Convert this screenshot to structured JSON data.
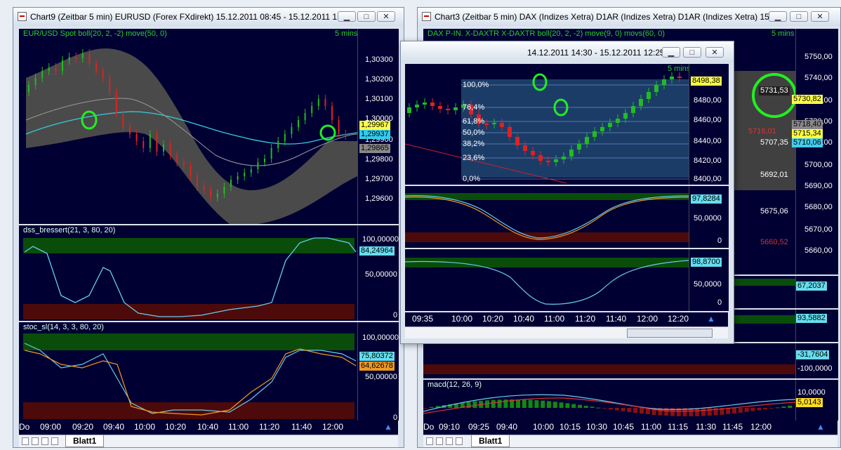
{
  "left": {
    "title": "Chart9 (Zeitbar 5 min)  EURUSD (Forex FXdirekt) 15.12.2011 08:45 - 15.12.2011 1...",
    "price_label": "EUR/USD Spot boll(20, 2, -2) move(50, 0)",
    "timeframe": "5 mins",
    "price_axis": [
      "1,30300",
      "1,30200",
      "1,30100",
      "1,30000",
      "1,29900",
      "1,29800",
      "1,29700",
      "1,29600"
    ],
    "tags": [
      "1,29967",
      "1,29937",
      "1,29865"
    ],
    "dss_label": "dss_bressert(21, 3, 80, 20)",
    "dss_axis": [
      "100,00000",
      "50,00000",
      "0"
    ],
    "dss_tag": "84,24964",
    "stoc_label": "stoc_sl(14, 3, 3, 80, 20)",
    "stoc_axis": [
      "100,00000",
      "50,00000",
      "0"
    ],
    "stoc_tags": [
      "75,80372",
      "64,62678"
    ],
    "xaxis": [
      "Do",
      "09:00",
      "09:20",
      "09:40",
      "10:00",
      "10:20",
      "10:40",
      "11:00",
      "11:20",
      "11:40",
      "12:00"
    ],
    "sheet": "Blatt1"
  },
  "right": {
    "title": "Chart3 (Zeitbar 5 min)  DAX (Indizes Xetra) D1AR (Indizes Xetra) D1AR (Indizes Xetra) 15...",
    "price_label": "DAX P-IN. X-DAXTR X-DAXTR boll(20, 2, -2) move(9, 0) movs(60, 0)",
    "timeframe": "5 mins",
    "price_axis": [
      "5750,00",
      "5740,00",
      "5730,00",
      "5720,00",
      "5710,00",
      "5700,00",
      "5690,00",
      "5680,00",
      "5670,00",
      "5660,00"
    ],
    "tags": [
      "5731,53",
      "5730,82",
      "5718,40",
      "5715,34",
      "5710,06",
      "5716,01"
    ],
    "levels": [
      "5707,35",
      "5692,01",
      "5675,06",
      "5660,52"
    ],
    "ind1_tag": "67,2037",
    "ind2_tag": "93,5882",
    "ind3_tag": "-31,7604",
    "ind3_axis": "-100,0000",
    "macd_label": "macd(12, 26, 9)",
    "macd_axis": "10,0000",
    "macd_tag": "5,0143",
    "xaxis": [
      "Do",
      "09:10",
      "09:25",
      "09:40",
      "10:00",
      "10:15",
      "10:30",
      "10:45",
      "11:00",
      "11:15",
      "11:30",
      "11:45",
      "12:00"
    ],
    "sheet": "Blatt1"
  },
  "popup": {
    "title": "14.12.2011 14:30 - 15.12.2011 12:25",
    "timeframe": "5 mins",
    "fib": [
      "100,0%",
      "76,4%",
      "61,8%",
      "50,0%",
      "38,2%",
      "23,6%",
      "0,0%"
    ],
    "price_axis": [
      "8480,00",
      "8460,00",
      "8440,00",
      "8420,00",
      "8400,00"
    ],
    "price_tag": "8498,38",
    "ind1_axis": [
      "50,0000",
      "0"
    ],
    "ind1_tag": "97,8284",
    "ind2_axis": [
      "50,0000",
      "0"
    ],
    "ind2_tag": "98,8700",
    "xaxis": [
      "09:35",
      "10:00",
      "10:20",
      "10:40",
      "11:00",
      "11:20",
      "11:40",
      "12:00",
      "12:20"
    ]
  },
  "colors": {
    "pane_bg": "#000033",
    "bull": "#22bb22",
    "bear": "#dd2222",
    "band": "#555555",
    "ma": "#33ccdd",
    "overbought": "#0a4d0a",
    "oversold": "#4d0a0a",
    "highlight": "#22ee22"
  }
}
